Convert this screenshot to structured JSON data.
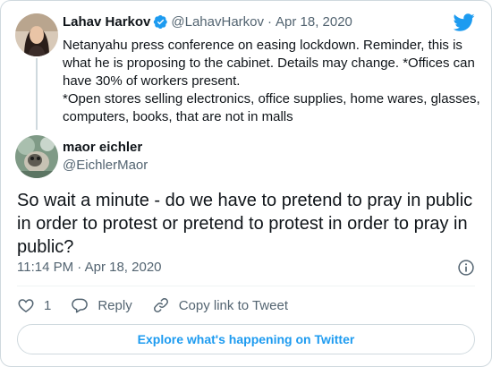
{
  "parent": {
    "name": "Lahav Harkov",
    "handle": "@LahavHarkov",
    "separator": "·",
    "date": "Apr 18, 2020",
    "text_1": "Netanyahu press conference on easing lockdown. Reminder, this is what he is proposing to the cabinet. Details may change. *Offices can have 30% of workers present.",
    "text_2": "*Open stores selling electronics, office supplies, home wares, glasses, computers, books, that are not in malls"
  },
  "tweet": {
    "name": "maor eichler",
    "handle": "@EichlerMaor",
    "text": "So wait a minute - do we have to pretend to pray in public in order to protest or pretend to protest in order to pray in public?",
    "time": "11:14 PM",
    "separator": "·",
    "date": "Apr 18, 2020"
  },
  "actions": {
    "like_count": "1",
    "reply_label": "Reply",
    "copy_link_label": "Copy link to Tweet"
  },
  "explore_label": "Explore what's happening on Twitter",
  "icons": {
    "brand": "twitter-bird-icon",
    "verified": "verified-badge-icon",
    "info": "info-icon",
    "like": "heart-icon",
    "reply": "reply-bubble-icon",
    "link": "link-icon"
  },
  "colors": {
    "brand_blue": "#1d9bf0",
    "text_primary": "#0f1419",
    "text_secondary": "#536471",
    "border": "#cfd9de"
  }
}
